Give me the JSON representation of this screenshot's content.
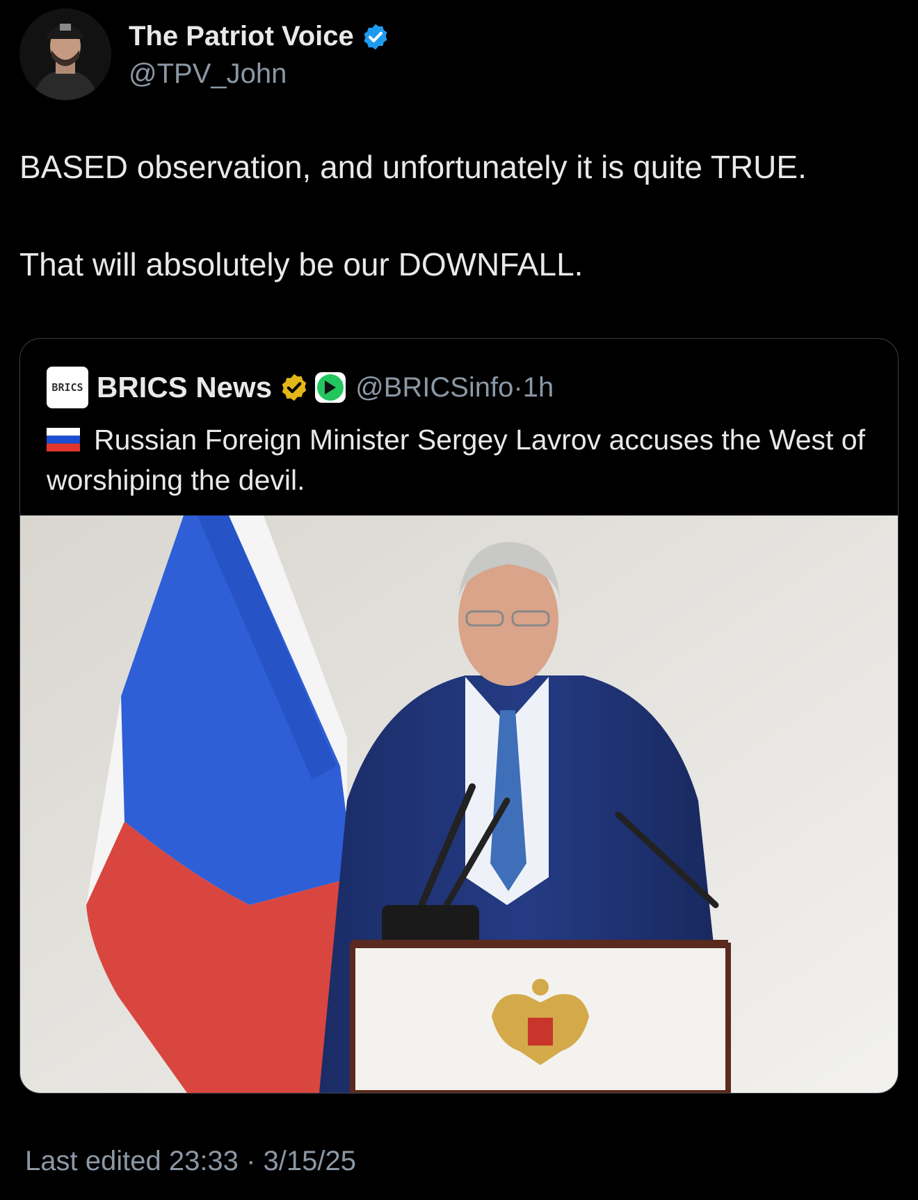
{
  "author": {
    "display_name": "The Patriot Voice",
    "handle": "@TPV_John",
    "verified_color": "#1d9bf0"
  },
  "tweet": {
    "paragraphs": [
      "BASED observation, and unfortunately it is quite TRUE.",
      "That will absolutely be our DOWNFALL."
    ]
  },
  "quoted_tweet": {
    "logo_text": "BRICS",
    "display_name": "BRICS News",
    "handle": "@BRICSinfo",
    "separator": "·",
    "time": "1h",
    "flag_icon": "russia-flag-icon",
    "text": "Russian Foreign Minister Sergey Lavrov accuses the West of worshiping the devil.",
    "badge_color": "#e2b719",
    "affiliate_color": "#22c55e"
  },
  "footer": {
    "label": "Last edited",
    "time": "23:33",
    "separator": "·",
    "date": "3/15/25"
  }
}
